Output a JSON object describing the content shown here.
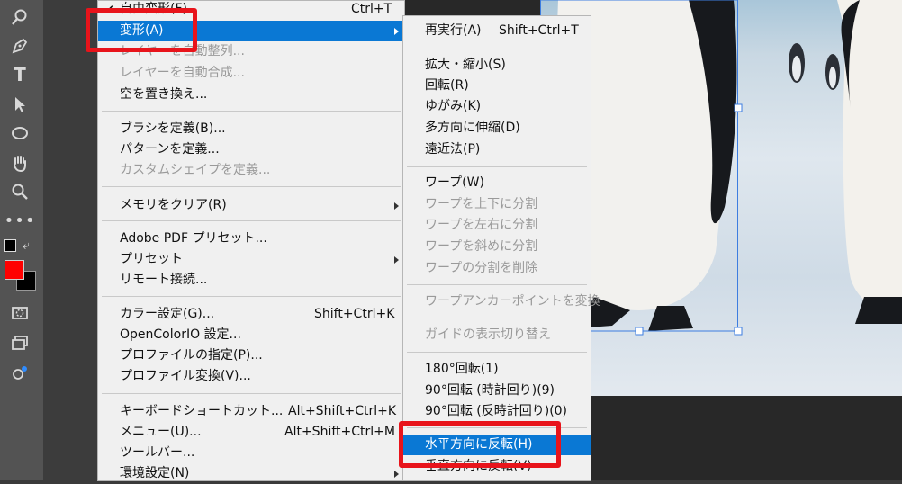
{
  "tools": [
    "zoom-tool-icon",
    "pen-icon",
    "type-icon",
    "path-select-icon",
    "ellipse-icon",
    "hand-icon",
    "zoom-icon",
    "more-icon"
  ],
  "colors": {
    "foreground": "#ff0000",
    "background": "#000000",
    "highlight": "#0a78d4",
    "callout": "#e8141b"
  },
  "main_menu": {
    "items": [
      {
        "label": "自由変形(F)",
        "shortcut": "Ctrl+T",
        "disabled": false
      },
      {
        "label": "変形(A)",
        "shortcut": "",
        "disabled": false,
        "highlighted": true,
        "submenu": true
      },
      {
        "label": "レイヤーを自動整列...",
        "shortcut": "",
        "disabled": true
      },
      {
        "label": "レイヤーを自動合成...",
        "shortcut": "",
        "disabled": true
      },
      {
        "label": "空を置き換え...",
        "shortcut": "",
        "disabled": false
      },
      {
        "label": "ブラシを定義(B)...",
        "shortcut": "",
        "disabled": false
      },
      {
        "label": "パターンを定義...",
        "shortcut": "",
        "disabled": false
      },
      {
        "label": "カスタムシェイプを定義...",
        "shortcut": "",
        "disabled": true
      },
      {
        "label": "メモリをクリア(R)",
        "shortcut": "",
        "disabled": false,
        "submenu": true
      },
      {
        "label": "Adobe PDF プリセット...",
        "shortcut": "",
        "disabled": false
      },
      {
        "label": "プリセット",
        "shortcut": "",
        "disabled": false,
        "submenu": true
      },
      {
        "label": "リモート接続...",
        "shortcut": "",
        "disabled": false
      },
      {
        "label": "カラー設定(G)...",
        "shortcut": "Shift+Ctrl+K",
        "disabled": false
      },
      {
        "label": "OpenColorIO 設定...",
        "shortcut": "",
        "disabled": false
      },
      {
        "label": "プロファイルの指定(P)...",
        "shortcut": "",
        "disabled": false
      },
      {
        "label": "プロファイル変換(V)...",
        "shortcut": "",
        "disabled": false
      },
      {
        "label": "キーボードショートカット...",
        "shortcut": "Alt+Shift+Ctrl+K",
        "disabled": false
      },
      {
        "label": "メニュー(U)...",
        "shortcut": "Alt+Shift+Ctrl+M",
        "disabled": false
      },
      {
        "label": "ツールバー...",
        "shortcut": "",
        "disabled": false
      },
      {
        "label": "環境設定(N)",
        "shortcut": "",
        "disabled": false,
        "submenu": true
      }
    ]
  },
  "sub_menu": {
    "items": [
      {
        "label": "再実行(A)",
        "shortcut": "Shift+Ctrl+T",
        "disabled": false
      },
      {
        "label": "拡大・縮小(S)",
        "shortcut": "",
        "disabled": false
      },
      {
        "label": "回転(R)",
        "shortcut": "",
        "disabled": false
      },
      {
        "label": "ゆがみ(K)",
        "shortcut": "",
        "disabled": false
      },
      {
        "label": "多方向に伸縮(D)",
        "shortcut": "",
        "disabled": false
      },
      {
        "label": "遠近法(P)",
        "shortcut": "",
        "disabled": false
      },
      {
        "label": "ワープ(W)",
        "shortcut": "",
        "disabled": false
      },
      {
        "label": "ワープを上下に分割",
        "shortcut": "",
        "disabled": true
      },
      {
        "label": "ワープを左右に分割",
        "shortcut": "",
        "disabled": true
      },
      {
        "label": "ワープを斜めに分割",
        "shortcut": "",
        "disabled": true
      },
      {
        "label": "ワープの分割を削除",
        "shortcut": "",
        "disabled": true
      },
      {
        "label": "ワープアンカーポイントを変換",
        "shortcut": "",
        "disabled": true
      },
      {
        "label": "ガイドの表示切り替え",
        "shortcut": "",
        "disabled": true
      },
      {
        "label": "180°回転(1)",
        "shortcut": "",
        "disabled": false
      },
      {
        "label": "90°回転 (時計回り)(9)",
        "shortcut": "",
        "disabled": false
      },
      {
        "label": "90°回転 (反時計回り)(0)",
        "shortcut": "",
        "disabled": false
      },
      {
        "label": "水平方向に反転(H)",
        "shortcut": "",
        "disabled": false,
        "highlighted": true
      },
      {
        "label": "垂直方向に反転(V)",
        "shortcut": "",
        "disabled": false
      }
    ]
  }
}
